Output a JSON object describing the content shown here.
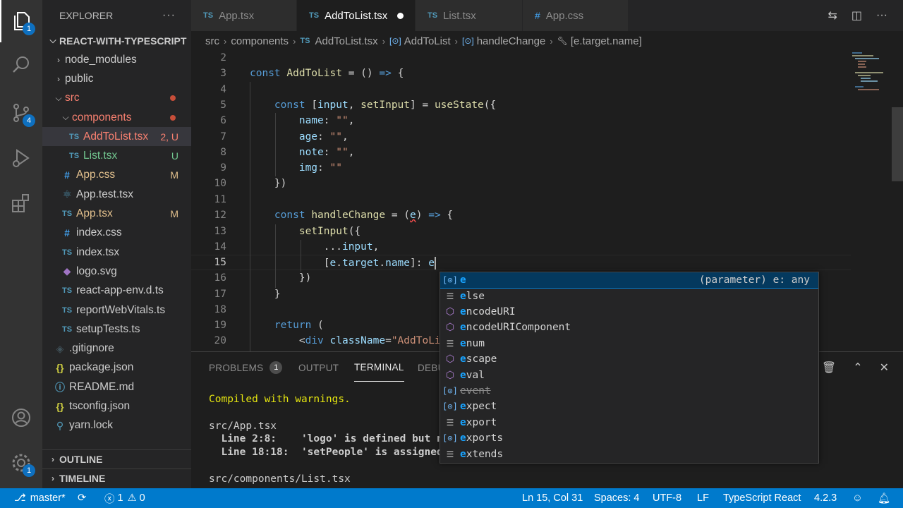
{
  "activity_bar": {
    "explorer_badge": "1",
    "scm_badge": "4",
    "settings_badge": "1"
  },
  "sidebar": {
    "header": "EXPLORER",
    "project": "REACT-WITH-TYPESCRIPT",
    "items": [
      {
        "label": "node_modules",
        "status": ""
      },
      {
        "label": "public",
        "status": ""
      },
      {
        "label": "src",
        "status": ""
      },
      {
        "label": "components",
        "status": ""
      },
      {
        "label": "AddToList.tsx",
        "status": "2, U"
      },
      {
        "label": "List.tsx",
        "status": "U"
      },
      {
        "label": "App.css",
        "status": "M"
      },
      {
        "label": "App.test.tsx",
        "status": ""
      },
      {
        "label": "App.tsx",
        "status": "M"
      },
      {
        "label": "index.css",
        "status": ""
      },
      {
        "label": "index.tsx",
        "status": ""
      },
      {
        "label": "logo.svg",
        "status": ""
      },
      {
        "label": "react-app-env.d.ts",
        "status": ""
      },
      {
        "label": "reportWebVitals.ts",
        "status": ""
      },
      {
        "label": "setupTests.ts",
        "status": ""
      },
      {
        "label": ".gitignore",
        "status": ""
      },
      {
        "label": "package.json",
        "status": ""
      },
      {
        "label": "README.md",
        "status": ""
      },
      {
        "label": "tsconfig.json",
        "status": ""
      },
      {
        "label": "yarn.lock",
        "status": ""
      }
    ],
    "outline": "OUTLINE",
    "timeline": "TIMELINE"
  },
  "tabs": [
    {
      "label": "App.tsx",
      "icon": "TS"
    },
    {
      "label": "AddToList.tsx",
      "icon": "TS"
    },
    {
      "label": "List.tsx",
      "icon": "TS"
    },
    {
      "label": "App.css",
      "icon": "#"
    }
  ],
  "breadcrumb": [
    "src",
    "components",
    "AddToList.tsx",
    "AddToList",
    "handleChange",
    "[e.target.name]"
  ],
  "editor": {
    "line_numbers": [
      "2",
      "3",
      "4",
      "5",
      "6",
      "7",
      "8",
      "9",
      "10",
      "11",
      "12",
      "13",
      "14",
      "15",
      "16",
      "17",
      "18",
      "19",
      "20"
    ]
  },
  "panel": {
    "tabs": [
      "PROBLEMS",
      "OUTPUT",
      "TERMINAL",
      "DEBU"
    ],
    "problems_count": "1",
    "terminal": [
      "Compiled with warnings.",
      "",
      "src/App.tsx",
      "  Line 2:8:    'logo' is defined but n",
      "  Line 18:18:  'setPeople' is assigned",
      "",
      "src/components/List.tsx"
    ]
  },
  "suggest": {
    "detail": "(parameter) e: any",
    "items": [
      {
        "label": "e",
        "kind": "variable"
      },
      {
        "label": "else",
        "kind": "keyword"
      },
      {
        "label": "encodeURI",
        "kind": "method"
      },
      {
        "label": "encodeURIComponent",
        "kind": "method"
      },
      {
        "label": "enum",
        "kind": "keyword"
      },
      {
        "label": "escape",
        "kind": "method"
      },
      {
        "label": "eval",
        "kind": "method"
      },
      {
        "label": "event",
        "kind": "variable"
      },
      {
        "label": "expect",
        "kind": "variable"
      },
      {
        "label": "export",
        "kind": "keyword"
      },
      {
        "label": "exports",
        "kind": "variable"
      },
      {
        "label": "extends",
        "kind": "keyword"
      }
    ]
  },
  "statusbar": {
    "branch": "master*",
    "errors": "1",
    "warnings": "0",
    "position": "Ln 15, Col 31",
    "spaces": "Spaces: 4",
    "encoding": "UTF-8",
    "eol": "LF",
    "language": "TypeScript React",
    "version": "4.2.3"
  },
  "colors": {
    "statusbar": "#007acc",
    "activity_bar": "#333333",
    "sidebar": "#252526",
    "editor": "#1e1e1e"
  }
}
